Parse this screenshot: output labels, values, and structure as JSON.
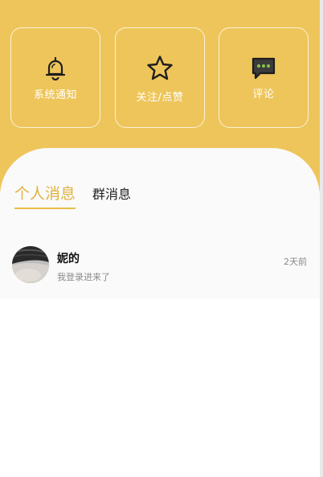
{
  "colors": {
    "accent": "#eec55a",
    "tab_active": "#e0b33f",
    "comment_dots": "#8bc34a"
  },
  "quick_actions": [
    {
      "label": "系统通知",
      "icon": "bell-icon"
    },
    {
      "label": "关注/点赞",
      "icon": "star-icon"
    },
    {
      "label": "评论",
      "icon": "comment-icon"
    }
  ],
  "tabs": {
    "personal": "个人消息",
    "group": "群消息",
    "active": "personal"
  },
  "messages": [
    {
      "name": "妮的",
      "preview": "我登录进来了",
      "time": "2天前",
      "avatar": "avatar-photo"
    }
  ]
}
